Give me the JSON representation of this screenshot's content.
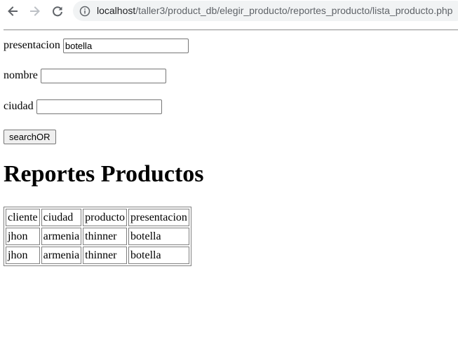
{
  "browser": {
    "back_icon": "arrow-left-icon",
    "forward_icon": "arrow-right-icon",
    "reload_icon": "reload-icon",
    "info_icon": "info-icon",
    "url_host": "localhost",
    "url_path": "/taller3/product_db/elegir_producto/reportes_producto/lista_producto.php"
  },
  "form": {
    "presentacion": {
      "label": "presentacion",
      "value": "botella"
    },
    "nombre": {
      "label": "nombre",
      "value": ""
    },
    "ciudad": {
      "label": "ciudad",
      "value": ""
    },
    "submit_label": "searchOR"
  },
  "report": {
    "title": "Reportes Productos",
    "headers": [
      "cliente",
      "ciudad",
      "producto",
      "presentacion"
    ],
    "rows": [
      [
        "jhon",
        "armenia",
        "thinner",
        "botella"
      ],
      [
        "jhon",
        "armenia",
        "thinner",
        "botella"
      ]
    ]
  }
}
